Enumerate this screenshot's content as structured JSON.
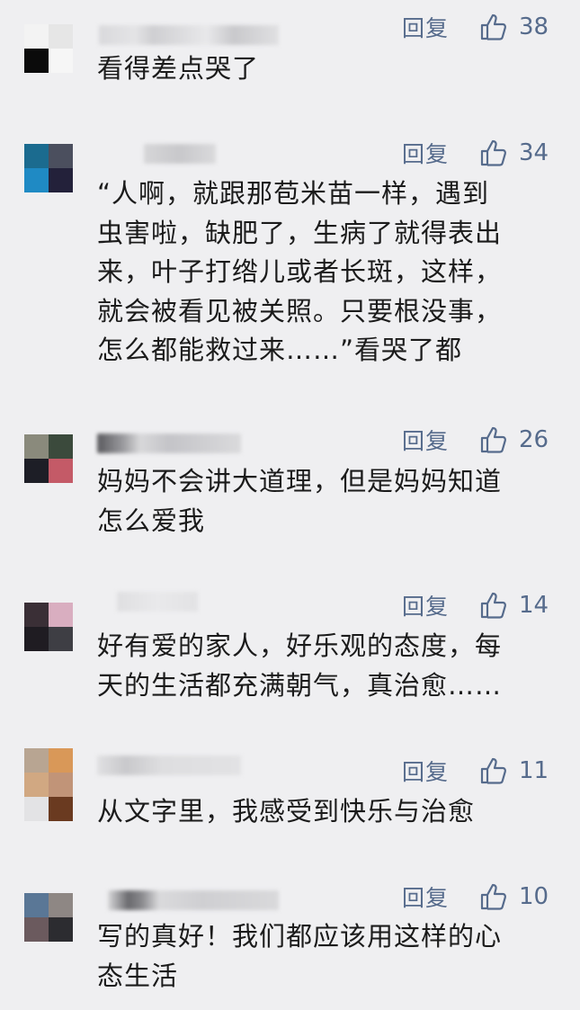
{
  "reply_label": "回复",
  "icons": {
    "like": "thumbs-up-icon"
  },
  "colors": {
    "accent": "#566b8c",
    "background": "#efeff1",
    "text": "#1b1b1b"
  },
  "comments": [
    {
      "likes": "38",
      "text": "看得差点哭了"
    },
    {
      "likes": "34",
      "text": "“人啊，就跟那苞米苗一样，遇到\n虫害啦，缺肥了，生病了就得表出\n来，叶子打绺儿或者长斑，这样，\n就会被看见被关照。只要根没事，\n怎么都能救过来……”看哭了都"
    },
    {
      "likes": "26",
      "text": "妈妈不会讲大道理，但是妈妈知道\n怎么爱我"
    },
    {
      "likes": "14",
      "text": "好有爱的家人，好乐观的态度，每\n天的生活都充满朝气，真治愈……"
    },
    {
      "likes": "11",
      "text": "从文字里，我感受到快乐与治愈"
    },
    {
      "likes": "10",
      "text": "写的真好！我们都应该用这样的心\n态生活"
    }
  ]
}
